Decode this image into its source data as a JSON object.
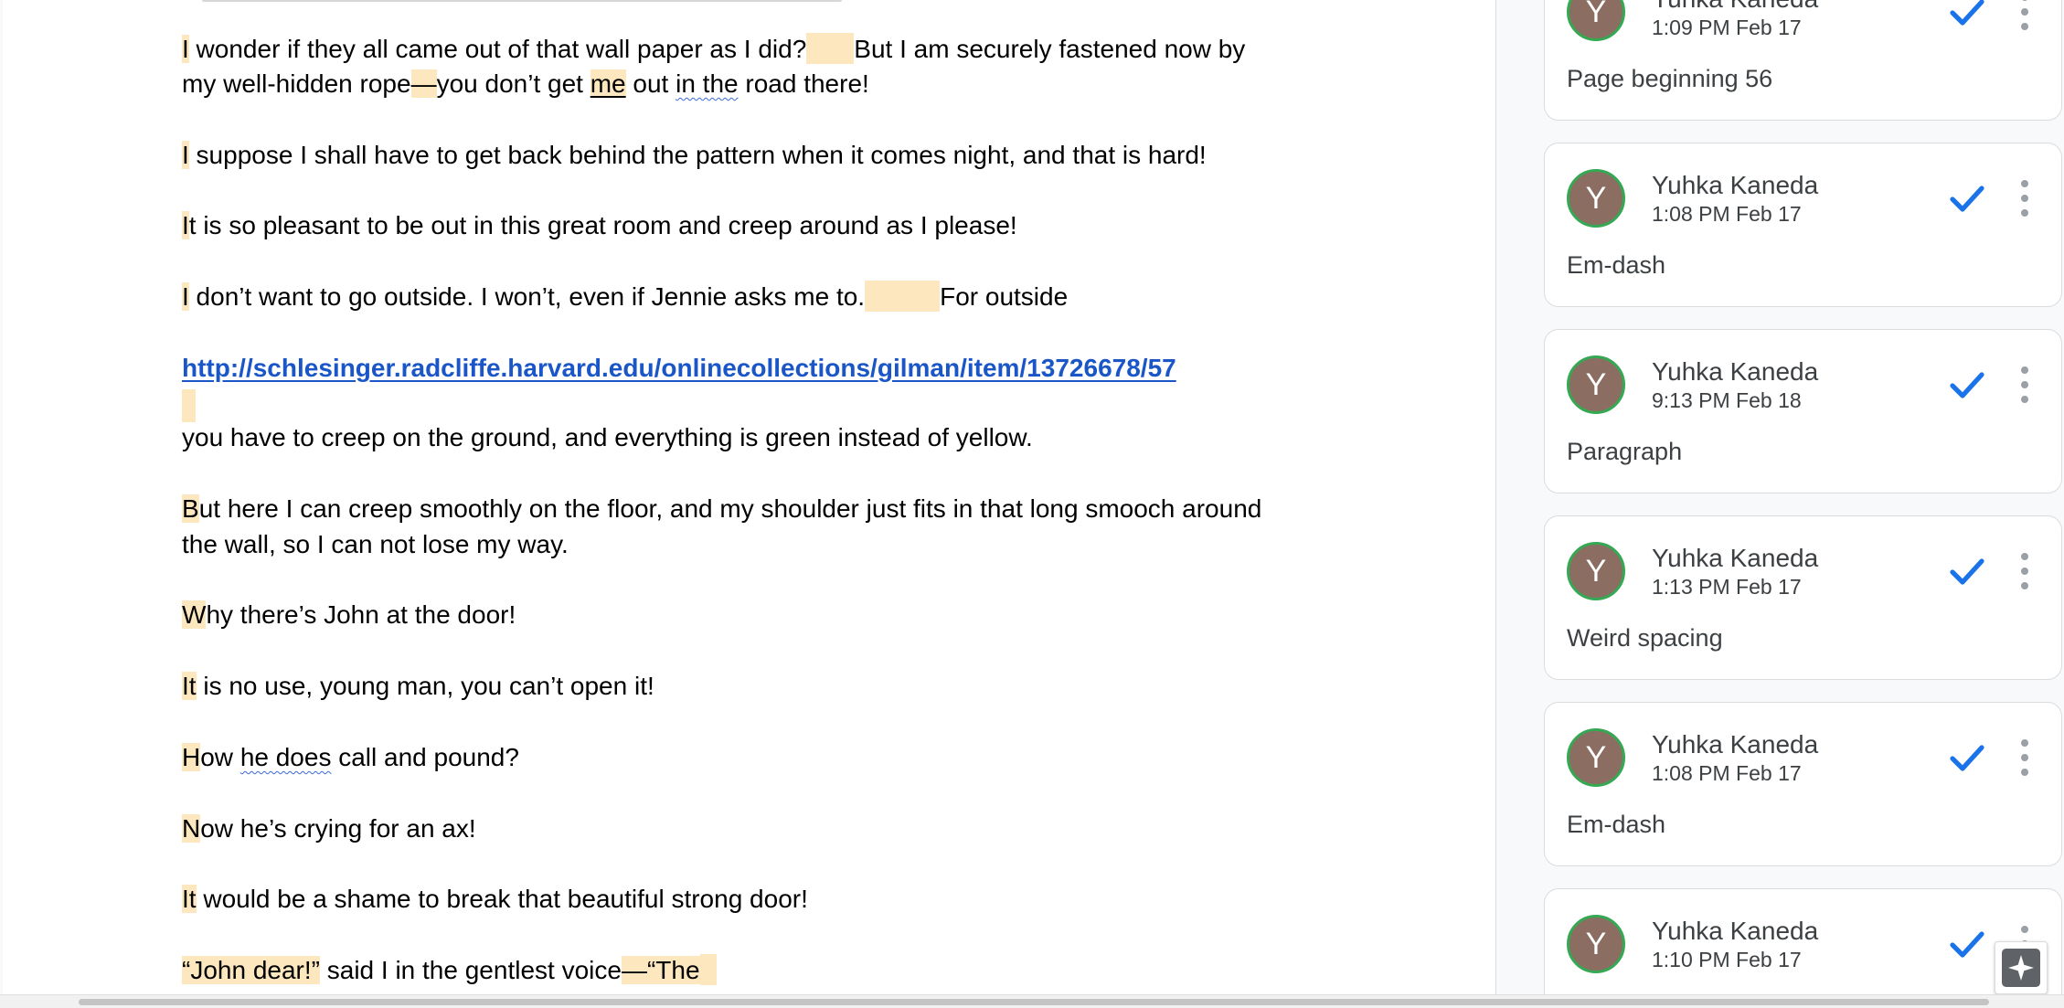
{
  "document": {
    "paragraphs": {
      "p1a": "I",
      "p1b": " wonder if they all came out of that wall paper as I did?",
      "p1c": "But I am securely fastened now by",
      "p2a": "my well-hidden rope",
      "p2b": "—",
      "p2c": "you don’t get ",
      "p2d": "me",
      "p2e": " out ",
      "p2f": "in the",
      "p2g": " road there!",
      "p3a": "I",
      "p3b": " suppose I shall have to get back behind the pattern when it comes night, and that is hard!",
      "p4a": "I",
      "p4b": "t is so pleasant to be out in this great room and creep around as I please!",
      "p5a": "I",
      "p5b": " don’t want to go outside. I won’t, even if Jennie asks me to.",
      "p5c": "For outside",
      "link": "http://schlesinger.radcliffe.harvard.edu/onlinecollections/gilman/item/13726678/57",
      "p6": "you have to creep on the ground, and everything is green instead of yellow.",
      "p7a": "B",
      "p7b": "ut here I can creep smoothly on the floor, and my shoulder just fits in that long smooch around",
      "p7c": "the wall, so I can not lose my way.",
      "p8a": "W",
      "p8b": "hy there’s John at the door!",
      "p9a": "It",
      "p9b": " is no use, young man, you can’t open it!",
      "p10a": "H",
      "p10b": "ow ",
      "p10c": "he does",
      "p10d": " call and pound?",
      "p11a": "N",
      "p11b": "ow he’s crying for an ax!",
      "p12a": "It",
      "p12b": " would be a shame to break that beautiful strong door!",
      "p13a": "“John dear!”",
      "p13b": " said I in the gentlest voice",
      "p13c": "—“The"
    }
  },
  "comments": [
    {
      "author": "Yuhka Kaneda",
      "time": "1:09 PM Feb 17",
      "text": "Page beginning 56",
      "avatar_letter": "Y"
    },
    {
      "author": "Yuhka Kaneda",
      "time": "1:08 PM Feb 17",
      "text": "Em-dash",
      "avatar_letter": "Y"
    },
    {
      "author": "Yuhka Kaneda",
      "time": "9:13 PM Feb 18",
      "text": "Paragraph",
      "avatar_letter": "Y"
    },
    {
      "author": "Yuhka Kaneda",
      "time": "1:13 PM Feb 17",
      "text": "Weird spacing",
      "avatar_letter": "Y"
    },
    {
      "author": "Yuhka Kaneda",
      "time": "1:08 PM Feb 17",
      "text": "Em-dash",
      "avatar_letter": "Y"
    },
    {
      "author": "Yuhka Kaneda",
      "time": "1:10 PM Feb 17",
      "text": "",
      "avatar_letter": "Y"
    }
  ],
  "colors": {
    "highlight": "#fde7bf",
    "link": "#1a56c8",
    "avatar_bg": "#8b6e61",
    "avatar_ring": "#35a853",
    "resolve_check": "#1a73e8"
  },
  "icons": {
    "resolve": "checkmark-icon",
    "more": "more-vert-icon",
    "explore": "explore-sparkle-icon"
  }
}
